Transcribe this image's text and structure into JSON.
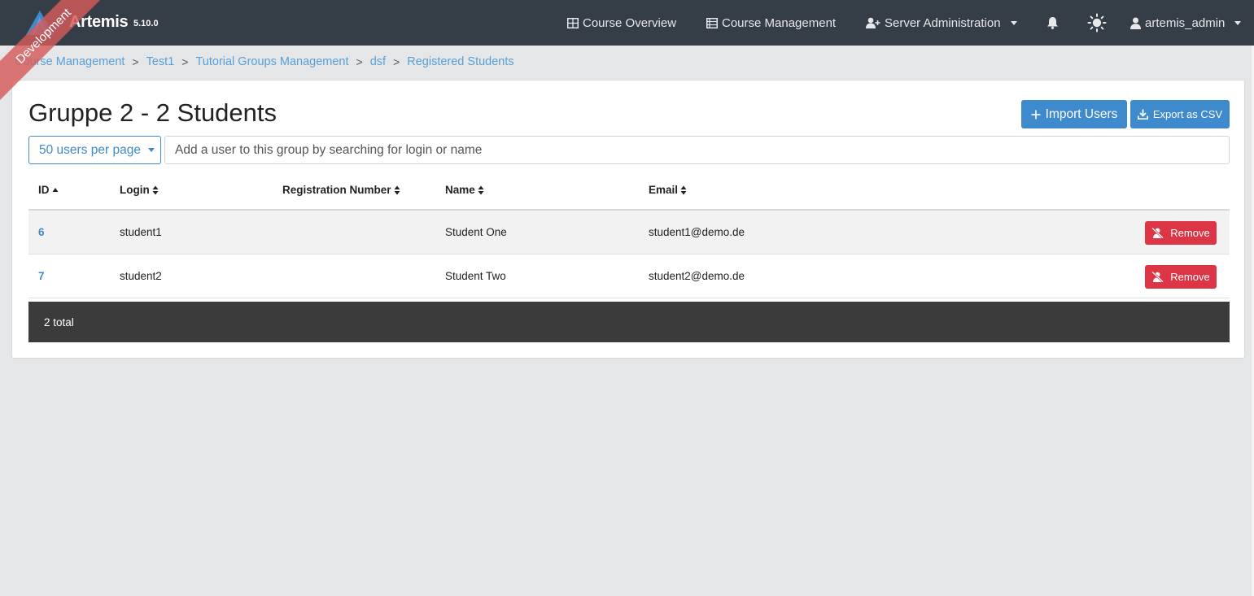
{
  "app": {
    "name": "Artemis",
    "version": "5.10.0",
    "ribbon": "Development"
  },
  "nav": {
    "course_overview": "Course Overview",
    "course_management": "Course Management",
    "server_administration": "Server Administration",
    "user": "artemis_admin",
    "icons": [
      "grid-icon",
      "list-icon",
      "user-plus-icon",
      "bell-icon",
      "sun-icon",
      "user-icon"
    ]
  },
  "breadcrumb": {
    "items": [
      "Course Management",
      "Test1",
      "Tutorial Groups Management",
      "dsf",
      "Registered Students"
    ],
    "separator": ">"
  },
  "page": {
    "title": "Gruppe 2 - 2 Students",
    "import_label": "Import Users",
    "export_label": "Export as CSV",
    "page_size_label": "50 users per page",
    "search_placeholder": "Add a user to this group by searching for login or name"
  },
  "table": {
    "columns": [
      "ID",
      "Login",
      "Registration Number",
      "Name",
      "Email"
    ],
    "rows": [
      {
        "id": "6",
        "login": "student1",
        "registration_number": "",
        "name": "Student One",
        "email": "student1@demo.de",
        "action": "Remove"
      },
      {
        "id": "7",
        "login": "student2",
        "registration_number": "",
        "name": "Student Two",
        "email": "student2@demo.de",
        "action": "Remove"
      }
    ],
    "footer": "2 total"
  },
  "colors": {
    "navbar": "#353d47",
    "primary": "#3e8acc",
    "danger": "#dc3545",
    "footer": "#3b3b3b",
    "background": "#e5e6e7"
  }
}
